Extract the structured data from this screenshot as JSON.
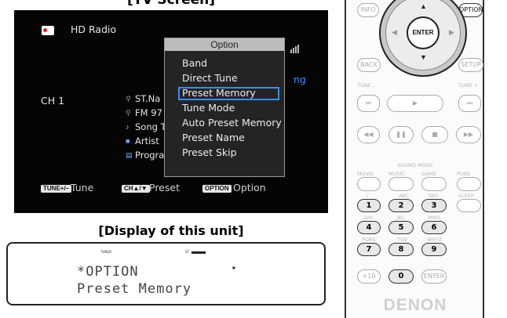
{
  "tv_screen": {
    "title": "[TV Screen]",
    "source": "HD Radio",
    "channel": "CH 1",
    "status_right": "ng",
    "info_lines": [
      "ST.Na",
      "FM 97",
      "Song T",
      "Artist",
      "Progra"
    ],
    "popup": {
      "title": "Option",
      "items": [
        "Band",
        "Direct Tune",
        "Preset Memory",
        "Tune Mode",
        "Auto Preset Memory",
        "Preset Name",
        "Preset Skip"
      ],
      "selected_index": 2
    },
    "bottom_bar": {
      "tune_btn": "TUNE+/–",
      "tune_label": "Tune",
      "ch_btn": "CH▲/▼",
      "ch_label": "Preset",
      "option_btn": "OPTION",
      "option_label": "Option"
    }
  },
  "unit_display": {
    "title": "[Display of this unit]",
    "line1": "*OPTION",
    "line2": "Preset Memory"
  },
  "remote": {
    "top_buttons": {
      "info": "INFO",
      "option": "OPTION",
      "back": "BACK",
      "setup": "SETUP",
      "enter": "ENTER"
    },
    "tune_minus": "TUNE –",
    "tune_plus": "TUNE +",
    "sound_mode": "SOUND MODE",
    "mode_labels": [
      "MOVIE",
      "MUSIC",
      "GAME",
      "PURE"
    ],
    "key_letters": [
      "/",
      "ABC",
      "DEF",
      "SLEEP",
      "GHI",
      "JKL",
      "MNO",
      "PQRS",
      "TUV",
      "WXYZ"
    ],
    "num_keys": [
      "1",
      "2",
      "3",
      "4",
      "5",
      "6",
      "7",
      "8",
      "9",
      "0"
    ],
    "plus10": "+10",
    "enter_small": "ENTER",
    "brand": "DENON"
  }
}
